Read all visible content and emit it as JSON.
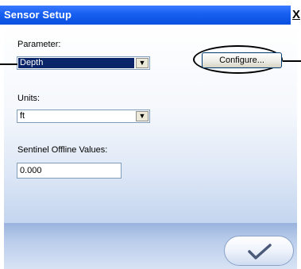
{
  "window": {
    "title": "Sensor Setup",
    "close_label": "X"
  },
  "parameter": {
    "label": "Parameter:",
    "value": "Depth"
  },
  "configure": {
    "label": "Configure..."
  },
  "units": {
    "label": "Units:",
    "value": "ft"
  },
  "sentinel": {
    "label": "Sentinel Offline Values:",
    "value": "0.000"
  },
  "icons": {
    "dropdown": "chevron-down-icon",
    "ok": "checkmark-icon"
  },
  "colors": {
    "title_bar": "#175ff0",
    "selection": "#0a246a",
    "field_border": "#7f9db9"
  }
}
